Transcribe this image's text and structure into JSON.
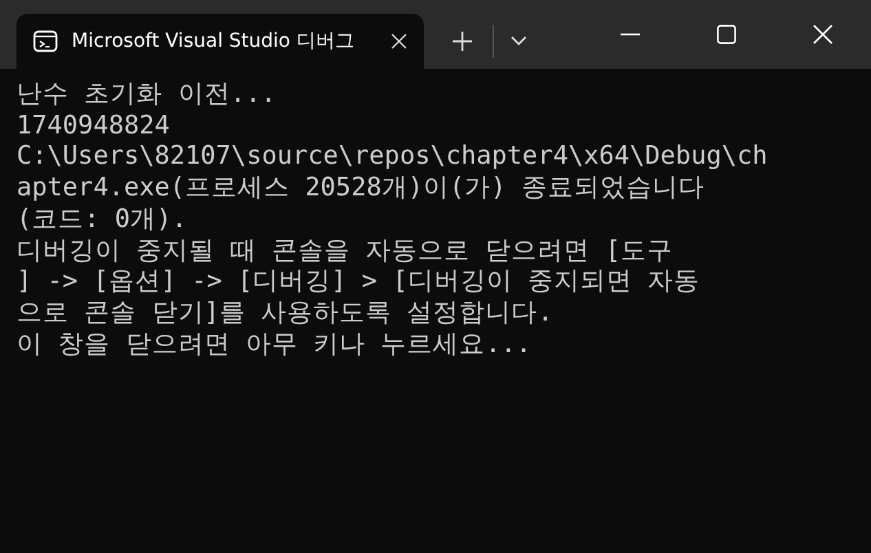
{
  "window": {
    "tab_title": "Microsoft Visual Studio 디버그"
  },
  "console": {
    "lines": [
      "난수 초기화 이전...",
      "1740948824",
      "C:\\Users\\82107\\source\\repos\\chapter4\\x64\\Debug\\ch",
      "apter4.exe(프로세스 20528개)이(가) 종료되었습니다",
      "(코드: 0개).",
      "디버깅이 중지될 때 콘솔을 자동으로 닫으려면 [도구",
      "] -> [옵션] -> [디버깅] > [디버깅이 중지되면 자동",
      "으로 콘솔 닫기]를 사용하도록 설정합니다.",
      "이 창을 닫으려면 아무 키나 누르세요..."
    ]
  }
}
